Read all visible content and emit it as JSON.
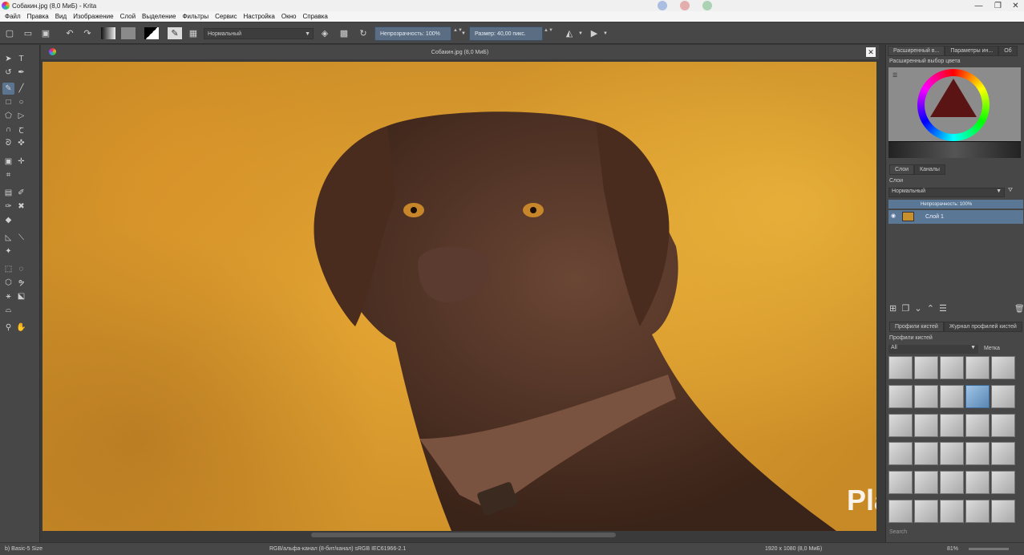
{
  "window": {
    "title": "Собакин.jpg (8,0 МиБ)  - Krita",
    "minimize": "—",
    "maximize": "❐",
    "close": "✕"
  },
  "menu": [
    "Файл",
    "Правка",
    "Вид",
    "Изображение",
    "Слой",
    "Выделение",
    "Фильтры",
    "Сервис",
    "Настройка",
    "Окно",
    "Справка"
  ],
  "toolbar": {
    "blend_mode": "Нормальный",
    "opacity": "Непрозрачность: 100%",
    "size_label": "Размер:",
    "size_value": "40,00 пикс."
  },
  "document": {
    "tab_title": "Собакин.jpg (8,0 МиБ)",
    "image_description": "photo of a brown labrador against a blurred yellow autumn background"
  },
  "dock": {
    "tab1": "Расширенный в...",
    "tab2": "Параметры ин...",
    "tab3": "Об",
    "color_panel_title": "Расширенный выбор цвета",
    "layers_tab": "Слои",
    "channels_tab": "Каналы",
    "layers_title": "Слои",
    "layer_blend": "Нормальный",
    "layer_opacity": "Непрозрачность: 100%",
    "layer_name": "Слой 1",
    "brush_tab1": "Профили кистей",
    "brush_tab2": "Журнал профилей кистей",
    "brush_title": "Профили кистей",
    "brush_filter": "All",
    "brush_tag": "Метка",
    "search": "Search"
  },
  "status": {
    "brush": "b) Basic-5 Size",
    "color_space": "RGB/альфа-канал (8-бит/канал)  sRGB IEC61966-2.1",
    "dimensions": "1920 x 1080 (8,0 МиБ)",
    "zoom": "81%"
  },
  "watermark": "Playerok",
  "colors": {
    "accent": "#5b7591",
    "panel": "#474747",
    "bg": "#3a3a3a"
  }
}
